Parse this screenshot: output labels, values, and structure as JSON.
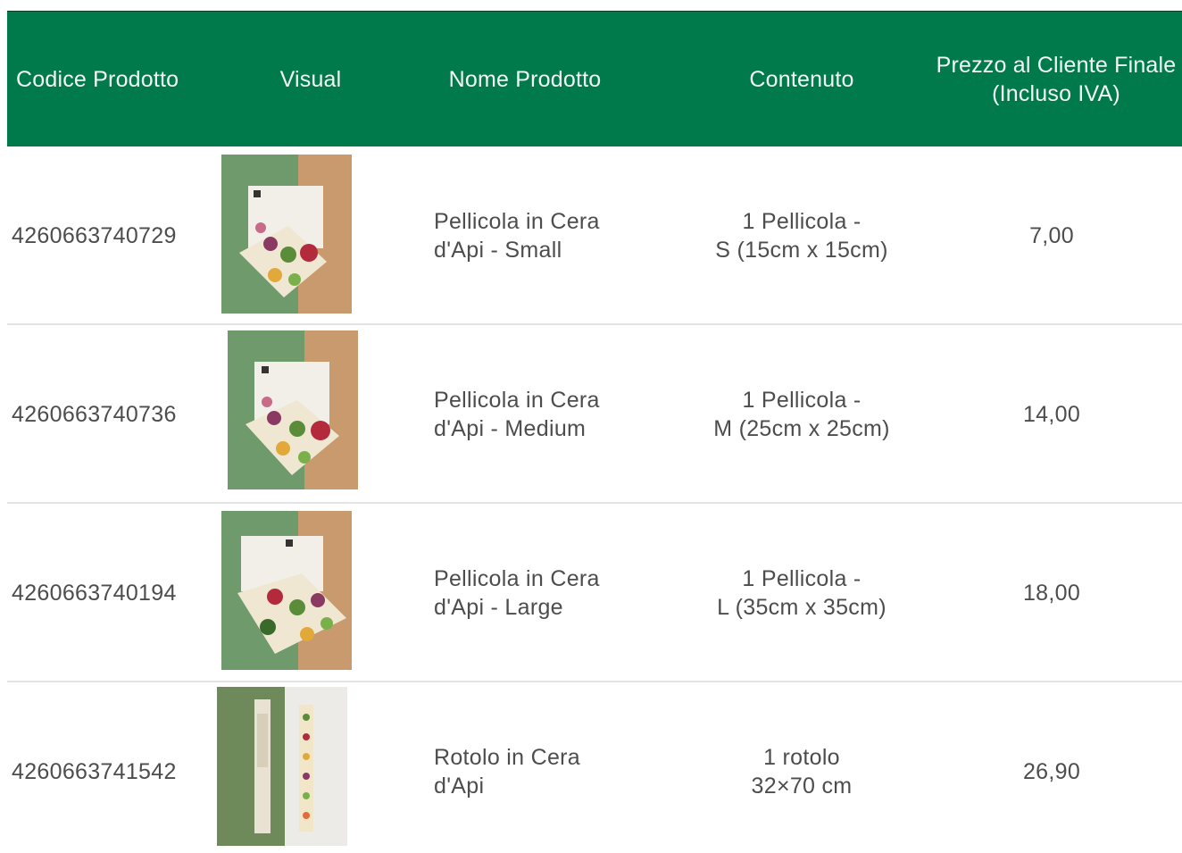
{
  "table": {
    "headers": {
      "code": "Codice Prodotto",
      "visual": "Visual",
      "name": "Nome Prodotto",
      "content": "Contenuto",
      "price": "Prezzo al Cliente Finale\n(Incluso IVA)"
    },
    "rows": [
      {
        "code": "4260663740729",
        "name": "Pellicola in Cera\nd'Api - Small",
        "content": "1 Pellicola -\nS (15cm x 15cm)",
        "price": "7,00",
        "visual_icon": "beeswax-wrap-small-image"
      },
      {
        "code": "4260663740736",
        "name": "Pellicola in Cera\nd'Api - Medium",
        "content": "1 Pellicola -\nM (25cm x 25cm)",
        "price": "14,00",
        "visual_icon": "beeswax-wrap-medium-image"
      },
      {
        "code": "4260663740194",
        "name": "Pellicola in Cera\nd'Api - Large",
        "content": "1 Pellicola -\nL (35cm x 35cm)",
        "price": "18,00",
        "visual_icon": "beeswax-wrap-large-image"
      },
      {
        "code": "4260663741542",
        "name": "Rotolo in Cera\nd'Api",
        "content": "1  rotolo\n32×70 cm",
        "price": "26,90",
        "visual_icon": "beeswax-roll-image"
      }
    ]
  },
  "colors": {
    "header_bg": "#007a4a",
    "header_text": "#f3f8f4",
    "row_text": "#4d4d4d",
    "separator": "#e3e3e3",
    "photo_green": "#6e9a6c",
    "photo_tan": "#c89a6e"
  }
}
